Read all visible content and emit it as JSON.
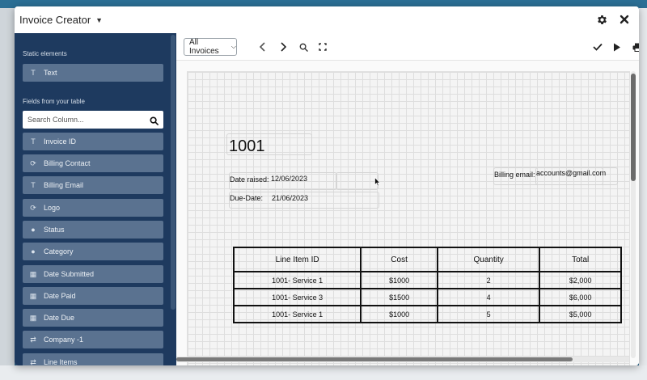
{
  "window": {
    "title": "Invoice Creator"
  },
  "sidebar": {
    "static_label": "Static elements",
    "static_items": [
      {
        "label": "Text",
        "icon": "text-icon"
      }
    ],
    "fields_label": "Fields from your table",
    "search": {
      "placeholder": "Search Column...",
      "value": ""
    },
    "fields": [
      {
        "label": "Invoice ID",
        "icon": "text-icon"
      },
      {
        "label": "Billing Contact",
        "icon": "link-icon"
      },
      {
        "label": "Billing Email",
        "icon": "text-icon"
      },
      {
        "label": "Logo",
        "icon": "link-icon"
      },
      {
        "label": "Status",
        "icon": "single-select-icon"
      },
      {
        "label": "Category",
        "icon": "single-select-icon"
      },
      {
        "label": "Date Submitted",
        "icon": "calendar-icon"
      },
      {
        "label": "Date Paid",
        "icon": "calendar-icon"
      },
      {
        "label": "Date Due",
        "icon": "calendar-icon"
      },
      {
        "label": "Company -1",
        "icon": "link-arrows-icon"
      },
      {
        "label": "Line Items",
        "icon": "link-arrows-icon"
      }
    ]
  },
  "toolbar": {
    "record_select": "All Invoices"
  },
  "invoice": {
    "id": "1001",
    "date_raised_label": "Date raised:",
    "date_raised_value": "12/06/2023",
    "due_date_label": "Due-Date:",
    "due_date_value": "21/06/2023",
    "billing_email_label": "Billing email:",
    "billing_email_value": "accounts@gmail.com"
  },
  "line_items_table": {
    "headers": [
      "Line Item ID",
      "Cost",
      "Quantity",
      "Total"
    ],
    "rows": [
      [
        "1001- Service 1",
        "$1000",
        "2",
        "$2,000"
      ],
      [
        "1001- Service 3",
        "$1500",
        "4",
        "$6,000"
      ],
      [
        "1001- Service 1",
        "$1000",
        "5",
        "$5,000"
      ]
    ]
  },
  "colors": {
    "sidebar_bg": "#1e3a5f",
    "field_button": "#5a7290",
    "backdrop": "#1f5f86"
  }
}
